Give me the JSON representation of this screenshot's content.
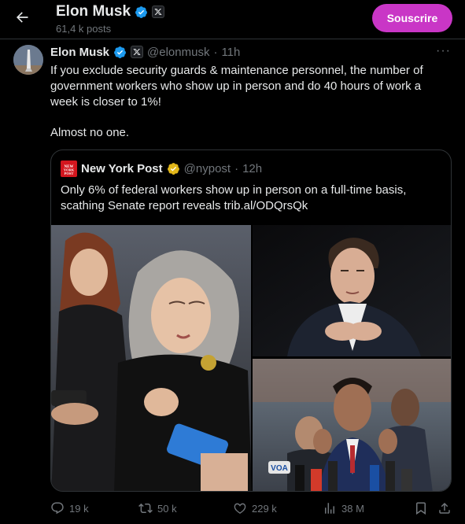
{
  "header": {
    "name": "Elon Musk",
    "posts_count": "61,4 k posts",
    "subscribe_label": "Souscrire"
  },
  "tweet": {
    "author_name": "Elon Musk",
    "handle": "@elonmusk",
    "separator": "·",
    "time": "11h",
    "more": "···",
    "text": "If you exclude security guards & maintenance personnel, the number of government workers who show up in person and do 40 hours of work a week is closer to 1%!",
    "text2": "Almost no one."
  },
  "quote": {
    "logo_text": "NEW YORK POST",
    "author_name": "New York Post",
    "handle": "@nypost",
    "separator": "·",
    "time": "12h",
    "text": "Only 6% of federal workers show up in person on a full-time basis, scathing Senate report reveals trib.al/ODQrsQk",
    "photo_caption": "VOA"
  },
  "actions": {
    "replies": "19 k",
    "reposts": "50 k",
    "likes": "229 k",
    "views": "38 M"
  },
  "colors": {
    "background": "#000000",
    "text": "#e7e9ea",
    "muted": "#71767b",
    "border": "#2f3336",
    "subscribe": "#c936c6",
    "verified": "#1d9bf0",
    "verified_org": "#e2b719",
    "nypost_red": "#d2161e"
  },
  "icons": [
    "back-arrow-icon",
    "verified-badge-icon",
    "x-logo-icon",
    "more-icon",
    "gold-verified-badge-icon",
    "reply-icon",
    "repost-icon",
    "like-icon",
    "views-icon",
    "bookmark-icon",
    "share-icon"
  ]
}
